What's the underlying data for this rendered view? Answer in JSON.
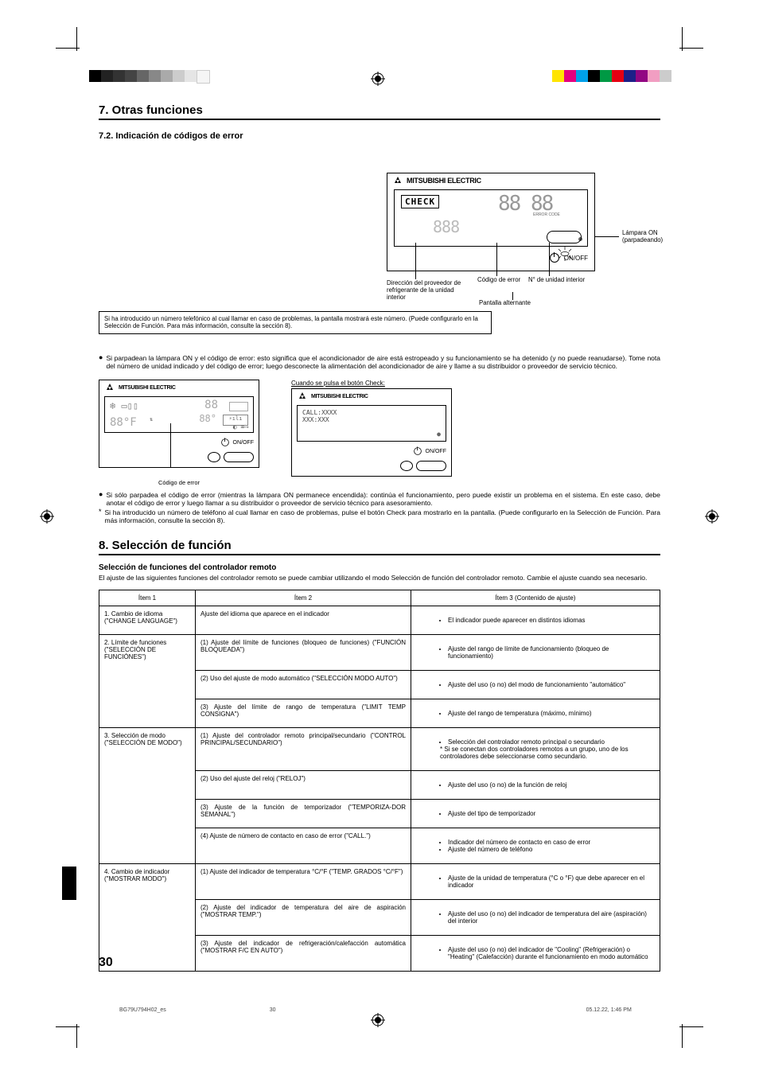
{
  "section7": {
    "title": "7. Otras funciones",
    "subtitle": "7.2.  Indicación de códigos de error"
  },
  "brand": "MITSUBISHI ELECTRIC",
  "lcd": {
    "check": "CHECK",
    "seg_large": "88 88",
    "seg_mid": "888",
    "err_tiny": "ERROR CODE",
    "call": "CALL:XXXX\nXXX:XXX"
  },
  "onoff": "ON/OFF",
  "callouts": {
    "lamp": "Lámpara ON\n(parpadeando)",
    "refrigerant": "Dirección del proveedor de refrigerante de la unidad interior",
    "error_code": "Código de error",
    "unit_no": "N° de unidad interior",
    "alt_screen": "Pantalla alternante"
  },
  "note_box": "Si ha introducido un número telefónico al cual llamar en caso de problemas, la pantalla mostrará este número. (Puede configurarlo en la Selección de Función. Para más información, consulte la sección 8).",
  "bullet1": "Si parpadean la lámpara ON y el código de error: esto significa que el acondicionador de aire está estropeado y su funcionamiento se ha detenido (y no puede reanudarse). Tome nota del número de unidad indicado y del código de error; luego desconecte la alimentación del acondicionador de aire y llame a su distribuidor o proveedor de servicio técnico.",
  "check_caption": "Cuando se pulsa el botón Check:",
  "small_fig_caption": "Código de error",
  "bullet2": "Si sólo parpadea el código de error (mientras la lámpara ON permanece encendida): continúa el funcionamiento, pero puede existir un problema en el sistema. En este caso, debe anotar el código de error y luego llamar a su distribuidor o proveedor de servicio técnico para asesoramiento.",
  "star_note": "Si ha introducido un número de teléfono al cual llamar en caso de problemas, pulse el botón Check para mostrarlo en la pantalla. (Puede configurarlo en la Selección de Función. Para más información, consulte la sección 8).",
  "section8": {
    "title": "8. Selección de función",
    "intro_title": "Selección de funciones del controlador remoto",
    "intro_text": "El ajuste de las siguientes funciones del controlador remoto se puede cambiar utilizando el modo Selección de función del controlador remoto. Cambie el ajuste cuando sea necesario.",
    "headers": {
      "c1": "Ítem 1",
      "c2": "Ítem 2",
      "c3": "Ítem 3 (Contenido de ajuste)"
    },
    "rows": [
      {
        "item1": "1. Cambio de idioma (\"CHANGE LANGUAGE\")",
        "subs": [
          {
            "item2": "Ajuste del idioma que aparece en el indicador",
            "item3": [
              "El indicador puede aparecer en distintos idiomas"
            ]
          }
        ]
      },
      {
        "item1": "2. Límite de funciones (\"SELECCIÓN DE FUNCIÓNES\")",
        "subs": [
          {
            "item2": "(1) Ajuste del límite de funciones (bloqueo de funciones) (\"FUNCIÓN BLOQUEADA\")",
            "item3": [
              "Ajuste del rango de límite de funcionamiento (bloqueo de funcionamiento)"
            ]
          },
          {
            "item2": "(2) Uso del ajuste de modo automático (\"SELECCIÓN MODO AUTO\")",
            "item3": [
              "Ajuste del uso (o no) del modo de funcionamiento \"automático\""
            ]
          },
          {
            "item2": "(3) Ajuste del límite de rango de temperatura (\"LIMIT TEMP CONSIGNA\")",
            "item3": [
              "Ajuste del rango de temperatura (máximo, mínimo)"
            ]
          }
        ]
      },
      {
        "item1": "3. Selección de modo (\"SELECCIÓN DE MODO\")",
        "subs": [
          {
            "item2": "(1) Ajuste del controlador remoto principal/secundario (\"CONTROL PRINCIPAL/SECUNDARIO\")",
            "item3": [
              "Selección del controlador remoto principal o secundario",
              "* Si se conectan dos controladores remotos a un grupo, uno de los controladores debe seleccionarse como secundario."
            ]
          },
          {
            "item2": "(2) Uso del ajuste del reloj (\"RELOJ\")",
            "item3": [
              "Ajuste del uso (o no) de la función de reloj"
            ]
          },
          {
            "item2": "(3) Ajuste de la función de temporizador (\"TEMPORIZA-DOR SEMANAL\")",
            "item3": [
              "Ajuste del tipo de temporizador"
            ]
          },
          {
            "item2": "(4) Ajuste de número de contacto en caso de error (\"CALL.\")",
            "item3": [
              "Indicador del número de contacto en caso de error",
              "Ajuste del número de teléfono"
            ]
          }
        ]
      },
      {
        "item1": "4. Cambio de indicador (\"MOSTRAR MODO\")",
        "subs": [
          {
            "item2": "(1) Ajuste del indicador de temperatura °C/°F (\"TEMP. GRADOS °C/°F\")",
            "item3": [
              "Ajuste de la unidad de temperatura (°C o °F) que debe aparecer en el indicador"
            ]
          },
          {
            "item2": "(2) Ajuste del indicador de temperatura del aire de aspiración (\"MOSTRAR TEMP.\")",
            "item3": [
              "Ajuste del uso (o no) del indicador de temperatura del aire (aspiración) del interior"
            ]
          },
          {
            "item2": "(3) Ajuste del indicador de refrigeración/calefacción automática (\"MOSTRAR F/C EN AUTO\")",
            "item3": [
              "Ajuste del uso (o no) del indicador de \"Cooling\" (Refrigeración) o \"Heating\" (Calefacción) durante el funcionamiento en modo automático"
            ]
          }
        ]
      }
    ]
  },
  "page_number": "30",
  "footer": {
    "file": "BG79U794H02_es",
    "page": "30",
    "datetime": "05.12.22, 1:46 PM"
  }
}
